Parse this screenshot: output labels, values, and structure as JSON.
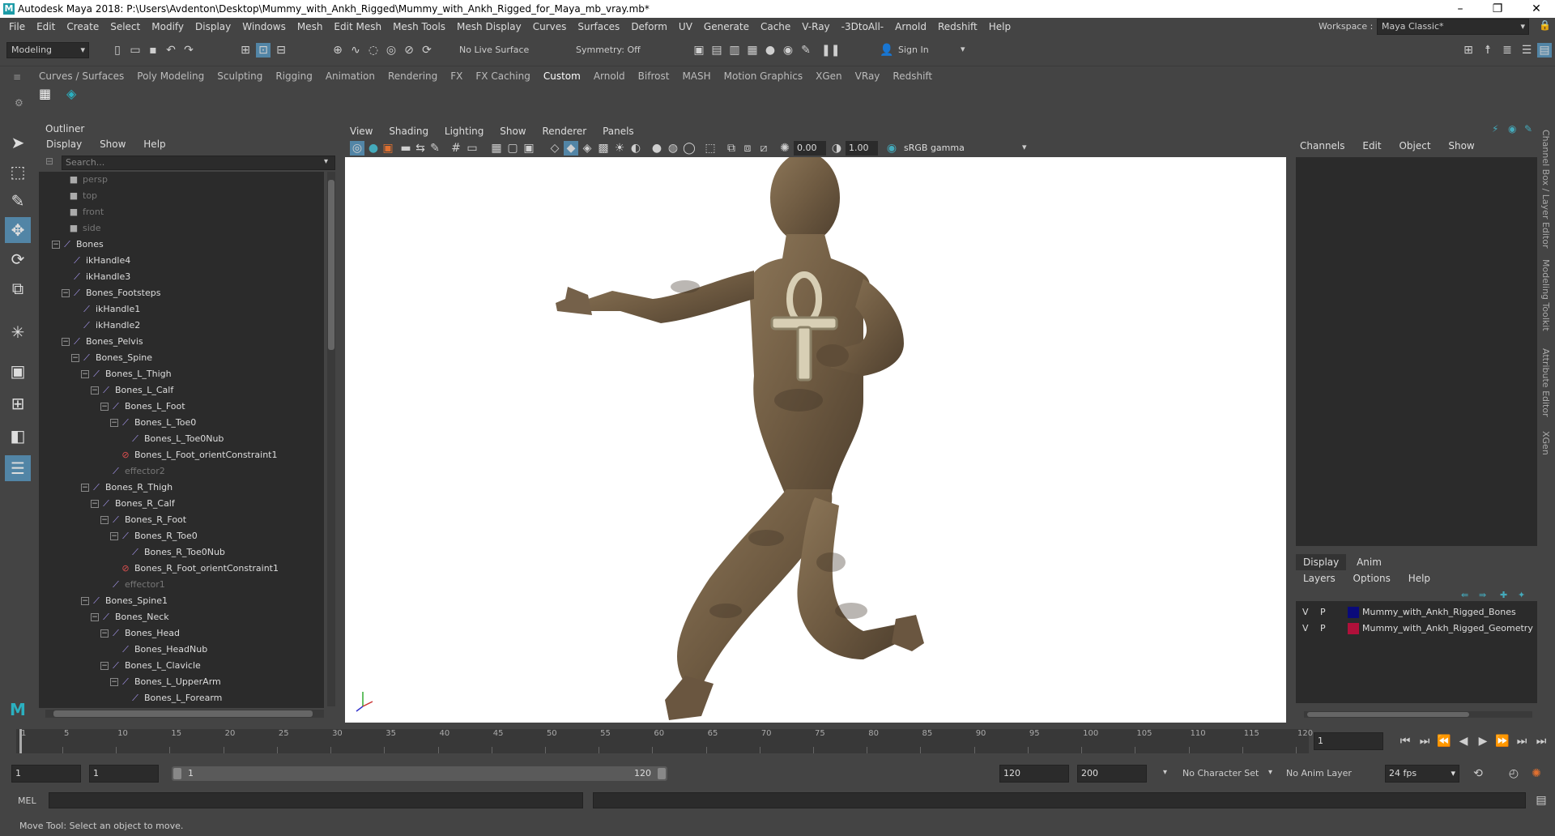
{
  "window": {
    "title": "Autodesk Maya 2018: P:\\Users\\Avdenton\\Desktop\\Mummy_with_Ankh_Rigged\\Mummy_with_Ankh_Rigged_for_Maya_mb_vray.mb*",
    "minimize": "–",
    "maximize": "❐",
    "close": "✕"
  },
  "menubar": [
    "File",
    "Edit",
    "Create",
    "Select",
    "Modify",
    "Display",
    "Windows",
    "Mesh",
    "Edit Mesh",
    "Mesh Tools",
    "Mesh Display",
    "Curves",
    "Surfaces",
    "Deform",
    "UV",
    "Generate",
    "Cache",
    "V-Ray",
    "-3DtoAll-",
    "Arnold",
    "Redshift",
    "Help"
  ],
  "workspace": {
    "label": "Workspace :",
    "value": "Maya Classic*"
  },
  "statusline": {
    "mode": "Modeling",
    "live_surface": "No Live Surface",
    "symmetry": "Symmetry: Off",
    "sign_in": "Sign In"
  },
  "shelf_tabs": [
    "Curves / Surfaces",
    "Poly Modeling",
    "Sculpting",
    "Rigging",
    "Animation",
    "Rendering",
    "FX",
    "FX Caching",
    "Custom",
    "Arnold",
    "Bifrost",
    "MASH",
    "Motion Graphics",
    "XGen",
    "VRay",
    "Redshift"
  ],
  "shelf_active": "Custom",
  "outliner": {
    "title": "Outliner",
    "menu": [
      "Display",
      "Show",
      "Help"
    ],
    "search_placeholder": "Search...",
    "nodes": [
      {
        "label": "persp",
        "dim": true
      },
      {
        "label": "top",
        "dim": true
      },
      {
        "label": "front",
        "dim": true
      },
      {
        "label": "side",
        "dim": true
      },
      {
        "label": "Bones"
      },
      {
        "label": "ikHandle4"
      },
      {
        "label": "ikHandle3"
      },
      {
        "label": "Bones_Footsteps"
      },
      {
        "label": "ikHandle1"
      },
      {
        "label": "ikHandle2"
      },
      {
        "label": "Bones_Pelvis"
      },
      {
        "label": "Bones_Spine"
      },
      {
        "label": "Bones_L_Thigh"
      },
      {
        "label": "Bones_L_Calf"
      },
      {
        "label": "Bones_L_Foot"
      },
      {
        "label": "Bones_L_Toe0"
      },
      {
        "label": "Bones_L_Toe0Nub"
      },
      {
        "label": "Bones_L_Foot_orientConstraint1"
      },
      {
        "label": "effector2",
        "dim": true
      },
      {
        "label": "Bones_R_Thigh"
      },
      {
        "label": "Bones_R_Calf"
      },
      {
        "label": "Bones_R_Foot"
      },
      {
        "label": "Bones_R_Toe0"
      },
      {
        "label": "Bones_R_Toe0Nub"
      },
      {
        "label": "Bones_R_Foot_orientConstraint1"
      },
      {
        "label": "effector1",
        "dim": true
      },
      {
        "label": "Bones_Spine1"
      },
      {
        "label": "Bones_Neck"
      },
      {
        "label": "Bones_Head"
      },
      {
        "label": "Bones_HeadNub"
      },
      {
        "label": "Bones_L_Clavicle"
      },
      {
        "label": "Bones_L_UpperArm"
      },
      {
        "label": "Bones_L_Forearm"
      }
    ]
  },
  "viewport": {
    "menu": [
      "View",
      "Shading",
      "Lighting",
      "Show",
      "Renderer",
      "Panels"
    ],
    "near_value": "0.00",
    "far_value": "1.00",
    "color_space": "sRGB gamma"
  },
  "channelbox": {
    "menu": [
      "Channels",
      "Edit",
      "Object",
      "Show"
    ]
  },
  "layers": {
    "tabs": [
      "Display",
      "Anim"
    ],
    "active_tab": "Display",
    "menu": [
      "Layers",
      "Options",
      "Help"
    ],
    "rows": [
      {
        "v": "V",
        "p": "P",
        "name": "Mummy_with_Ankh_Rigged_Bones",
        "color": "#0a0a7a"
      },
      {
        "v": "V",
        "p": "P",
        "name": "Mummy_with_Ankh_Rigged_Geometry",
        "color": "#b0103a"
      }
    ]
  },
  "side_tabs": [
    "Channel Box / Layer Editor",
    "Modeling Toolkit",
    "Attribute Editor",
    "XGen"
  ],
  "timeline": {
    "ticks": [
      "1",
      "5",
      "10",
      "15",
      "20",
      "25",
      "30",
      "35",
      "40",
      "45",
      "50",
      "55",
      "60",
      "65",
      "70",
      "75",
      "80",
      "85",
      "90",
      "95",
      "100",
      "105",
      "110",
      "115",
      "120"
    ],
    "current_frame": "1"
  },
  "range": {
    "start": "1",
    "playback_start": "1",
    "slider_start": "1",
    "slider_end": "120",
    "playback_end": "120",
    "end": "200",
    "character_set": "No Character Set",
    "anim_layer": "No Anim Layer",
    "fps": "24 fps"
  },
  "command": {
    "label": "MEL"
  },
  "help_line": "Move Tool: Select an object to move."
}
